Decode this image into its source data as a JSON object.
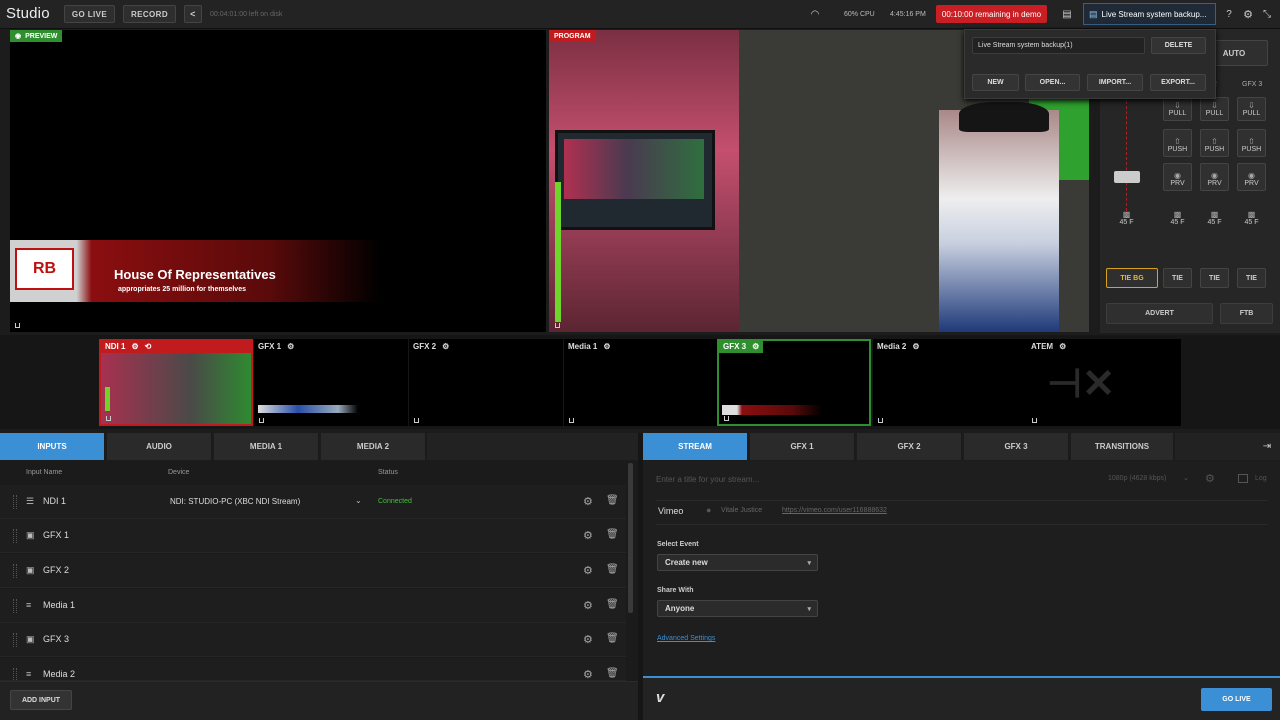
{
  "topbar": {
    "app_title": "Studio",
    "go_live": "GO LIVE",
    "record": "RECORD",
    "disk": "00:04:01:00 left on disk",
    "cpu": "60% CPU",
    "time": "4:45:16 PM",
    "demo": "00:10:00 remaining in demo",
    "file_name": "Live Stream system backup..."
  },
  "menu": {
    "file_name": "Live Stream system backup(1)",
    "delete": "DELETE",
    "new": "NEW",
    "open": "OPEN...",
    "import": "IMPORT...",
    "export": "EXPORT..."
  },
  "preview": {
    "label": "PREVIEW",
    "logo": "RB",
    "headline": "House Of Representatives",
    "sub": "appropriates  25 million for themselves"
  },
  "program": {
    "label": "PROGRAM"
  },
  "switcher": {
    "auto": "AUTO",
    "gfx2_short": "2",
    "gfx3": "GFX 3",
    "pull": "PULL",
    "push": "PUSH",
    "prv": "PRV",
    "frames": "45 F",
    "tie_bg": "TIE BG",
    "tie": "TIE",
    "advert": "ADVERT",
    "ftb": "FTB"
  },
  "thumbs": [
    {
      "label": "NDI 1"
    },
    {
      "label": "GFX 1"
    },
    {
      "label": "GFX 2"
    },
    {
      "label": "Media 1"
    },
    {
      "label": "GFX 3"
    },
    {
      "label": "Media 2"
    },
    {
      "label": "ATEM"
    }
  ],
  "left_tabs": [
    "INPUTS",
    "AUDIO",
    "MEDIA 1",
    "MEDIA 2"
  ],
  "right_tabs": [
    "STREAM",
    "GFX 1",
    "GFX 2",
    "GFX 3",
    "TRANSITIONS"
  ],
  "inputs": {
    "col_name": "Input Name",
    "col_device": "Device",
    "col_status": "Status",
    "rows": [
      {
        "name": "NDI 1",
        "device": "NDI: STUDIO-PC (XBC NDI Stream)",
        "status": "Connected"
      },
      {
        "name": "GFX 1"
      },
      {
        "name": "GFX 2"
      },
      {
        "name": "Media 1"
      },
      {
        "name": "GFX 3"
      },
      {
        "name": "Media 2"
      }
    ],
    "add": "ADD INPUT"
  },
  "stream": {
    "title_placeholder": "Enter a title for your stream...",
    "quality": "1080p (4628 kbps)",
    "log": "Log",
    "service": "Vimeo",
    "user": "Vitale Justice",
    "link": "https://vimeo.com/user116888632",
    "select_event_label": "Select Event",
    "select_event": "Create new",
    "share_label": "Share With",
    "share": "Anyone",
    "advanced": "Advanced Settings",
    "go_live": "GO LIVE"
  }
}
